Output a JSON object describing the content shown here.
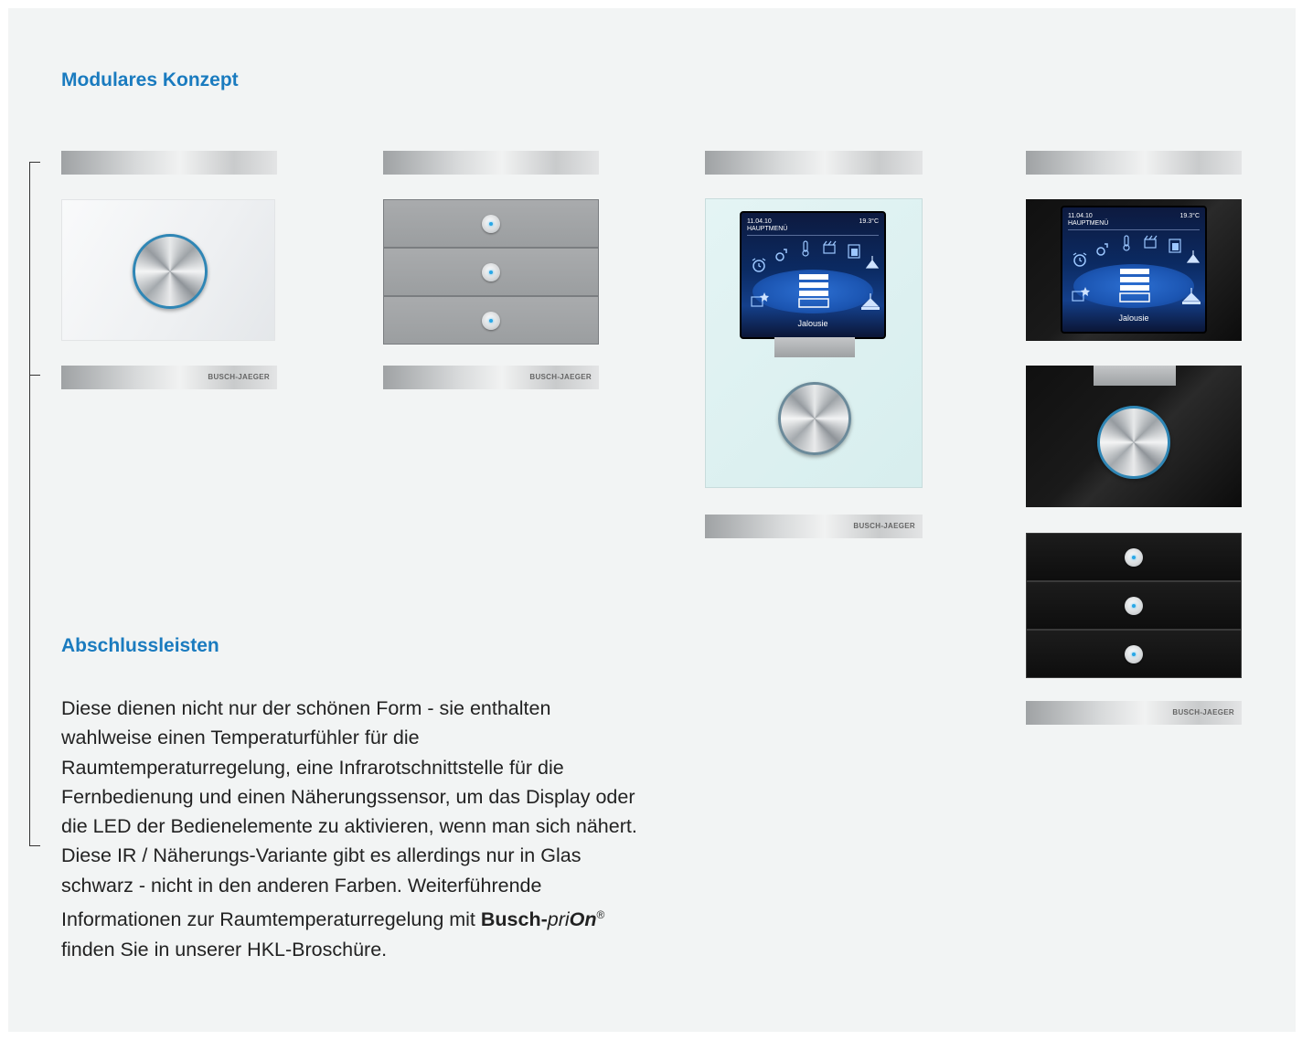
{
  "headings": {
    "modular": "Modulares Konzept",
    "abschluss": "Abschlussleisten"
  },
  "body": {
    "text_before_brand": "Diese dienen nicht nur der schönen Form - sie enthalten wahlweise einen Temperaturfühler für die Raumtemperaturregelung, eine Infrarotschnittstelle für die Fernbedienung und einen Näherungssensor, um das Display oder die LED der Bedienelemente zu aktivieren, wenn man sich nähert. Diese IR / Näherungs-Variante gibt es allerdings nur in Glas schwarz - nicht in den anderen Farben. Weiterführende Informationen zur Raumtemperaturregelung mit ",
    "brand_bold": "Busch-",
    "brand_pri": "pri",
    "brand_on": "On",
    "brand_reg": "®",
    "text_after_brand": " finden Sie in unserer HKL-Broschüre."
  },
  "strip_label": "BUSCH-JAEGER",
  "display": {
    "date": "11.04.10",
    "menu": "HAUPTMENÜ",
    "temperature": "19.3°C",
    "label": "Jalousie"
  }
}
